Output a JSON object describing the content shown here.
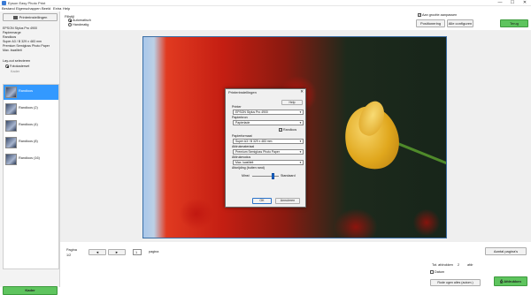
{
  "window": {
    "title": "Epson Easy Photo Print",
    "min": "—",
    "max": "☐",
    "close": "✕"
  },
  "menu": [
    "Bestand",
    "Eigenschappen",
    "Beeld",
    "Extra",
    "Help"
  ],
  "sidebar": {
    "printer_settings_label": "Printerinstellingen",
    "info": [
      "EPSON Stylus Pro 4900",
      "Papiermarge",
      "Randloos",
      "Super A3 / B 329 x 483 mm",
      "Premium Semigloss Photo Paper",
      "Max. kwaliteit"
    ],
    "layout_section": "Lay-out selecteren",
    "layout_type": "Fotokaderset",
    "layout_type_sub": "Kader",
    "layouts": [
      "Randloos",
      "Randloos (2)",
      "Randloos (4)",
      "Randloos (8)",
      "Randloos (16)"
    ],
    "frame_button": "Kader"
  },
  "toolbar": {
    "fill_type_label": "Fillstijl",
    "fill_auto": "Automatisch",
    "fill_manual": "Handmatig",
    "keep_ratio": "Aan grootte aanpassen",
    "position_label": "Positionering",
    "all_config_label": "Alle configuren",
    "back_label": "Terug"
  },
  "dialog": {
    "title": "Printerinstellingen",
    "help": "Help",
    "printer_label": "Printer",
    "printer_value": "EPSON Stylus Pro 4900",
    "paper_source_label": "Papierbron",
    "paper_source_value": "Papierlade",
    "borderless_label": "Randloos",
    "paper_size_label": "Papierformaat",
    "paper_size_value": "Super A3 / B 329 x 483 mm",
    "media_type_label": "Afdrukmateriaal",
    "media_type_value": "Premium Semigloss Photo Paper",
    "print_mode_label": "Afdrukmodus",
    "print_mode_value": "Max. kwaliteit",
    "expansion_label": "Afsnijding (buiten rand)",
    "expansion_min": "Minst",
    "expansion_std": "Standaard",
    "ok": "OK",
    "cancel": "Annuleren"
  },
  "pager": {
    "page_label": "Pagina",
    "page_count": "1/2",
    "prev": "◄",
    "next": "►",
    "current_page": "1",
    "suffix": "pagina",
    "adjust_label": "Aantal pagina's"
  },
  "footer": {
    "total_copies_label": "Tot. afdrukken",
    "total_copies_value": "2",
    "total_copies_unit": "afdr",
    "date_label": "Datum",
    "borders_label": "Rode ogen alles (autom.)",
    "print_label": "Afdrukken"
  },
  "colors": {
    "accent_green": "#5ec45e",
    "selection_blue": "#3399ff"
  },
  "icons": [
    "app-icon",
    "printer-icon",
    "photo-thumbnail-icon",
    "print-icon"
  ]
}
